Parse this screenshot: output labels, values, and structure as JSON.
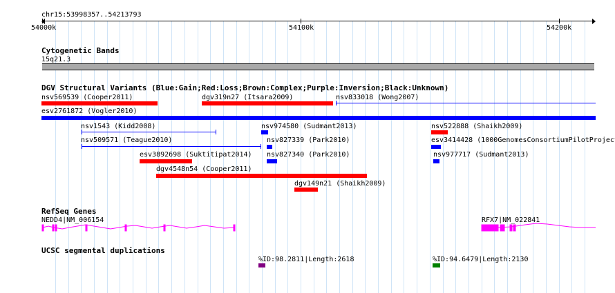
{
  "browser": {
    "location": "chr15:53998357..54213793",
    "ruler_labels": [
      "54000k",
      "54100k",
      "54200k"
    ]
  },
  "tracks": {
    "cytoband": {
      "title": "Cytogenetic Bands",
      "band_label": "15q21.3",
      "color": "#a9a9a9"
    },
    "dgv": {
      "title": "DGV Structural Variants (Blue:Gain;Red:Loss;Brown:Complex;Purple:Inversion;Black:Unknown)",
      "colors": {
        "gain": "#0000ff",
        "loss": "#ff0000"
      },
      "features": [
        {
          "label": "nsv569539 (Cooper2011)",
          "type": "loss"
        },
        {
          "label": "dgv319n27 (Itsara2009)",
          "type": "loss"
        },
        {
          "label": "nsv833018 (Wong2007)",
          "type": "gain-range"
        },
        {
          "label": "esv2761872 (Vogler2010)",
          "type": "gain"
        },
        {
          "label": "nsv1543 (Kidd2008)",
          "type": "gain-range"
        },
        {
          "label": "nsv974580 (Sudmant2013)",
          "type": "gain"
        },
        {
          "label": "nsv522888 (Shaikh2009)",
          "type": "loss"
        },
        {
          "label": "nsv509571 (Teague2010)",
          "type": "gain-range"
        },
        {
          "label": "nsv827339 (Park2010)",
          "type": "gain"
        },
        {
          "label": "esv3414428 (1000GenomesConsortiumPilotProject",
          "type": "gain"
        },
        {
          "label": "esv3892698 (Suktitipat2014)",
          "type": "loss"
        },
        {
          "label": "nsv827340 (Park2010)",
          "type": "gain"
        },
        {
          "label": "nsv977717 (Sudmant2013)",
          "type": "gain"
        },
        {
          "label": "dgv4548n54 (Cooper2011)",
          "type": "loss"
        },
        {
          "label": "dgv149n21 (Shaikh2009)",
          "type": "loss"
        }
      ]
    },
    "refseq": {
      "title": "RefSeq Genes",
      "color": "#ff00ff",
      "genes": [
        {
          "label": "NEDD4|NM_006154"
        },
        {
          "label": "RFX7|NM_022841"
        }
      ]
    },
    "segdup": {
      "title": "UCSC segmental duplications",
      "features": [
        {
          "label": "%ID:98.2811|Length:2618",
          "color": "#800080"
        },
        {
          "label": "%ID:94.6479|Length:2130",
          "color": "#008000"
        }
      ]
    }
  }
}
